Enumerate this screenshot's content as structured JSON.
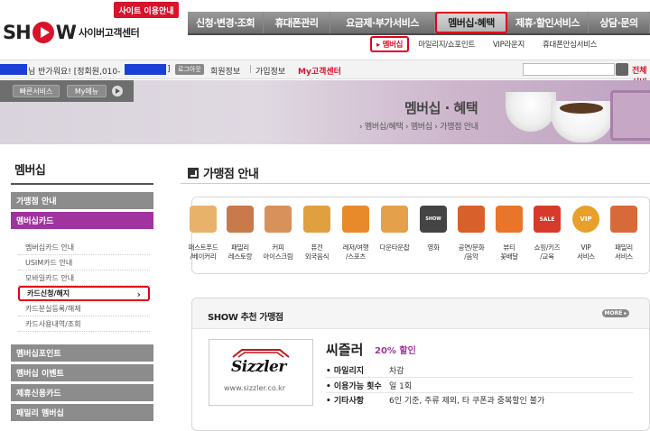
{
  "header": {
    "logo_word": "SH",
    "logo_word2": "W",
    "logo_sub": "사이버고객센터",
    "guide_label": "사이트 이용안내"
  },
  "gnb": [
    {
      "label": "신청·변경·조회",
      "active": false
    },
    {
      "label": "휴대폰관리",
      "active": false
    },
    {
      "label": "요금제·부가서비스",
      "active": false
    },
    {
      "label": "멤버십·혜택",
      "active": true
    },
    {
      "label": "제휴·할인서비스",
      "active": false
    },
    {
      "label": "상담·문의",
      "active": false
    }
  ],
  "subnav": [
    {
      "label": "멤버십",
      "active": true
    },
    {
      "label": "마일리지/쇼포인트",
      "active": false
    },
    {
      "label": "VIP라운지",
      "active": false
    },
    {
      "label": "휴대폰안심서비스",
      "active": false
    }
  ],
  "userbar": {
    "greeting": "님 반가워요! [정회원,010-",
    "greeting_end": "]",
    "logout": "로그아웃",
    "member_info": "회원정보",
    "sep": "|",
    "join_info": "가입정보",
    "my_center": "My고객센터",
    "all_services": "전체서비스"
  },
  "quick": {
    "quick_label": "빠른서비스",
    "my_menu_label": "My메뉴"
  },
  "banner": {
    "title": "멤버십 · 혜택",
    "breadcrumb": "› 멤버십/혜택 › 멤버십 › 가맹점 안내"
  },
  "leftnav": {
    "title": "멤버십",
    "main_top": [
      {
        "label": "가맹점 안내",
        "active": false
      },
      {
        "label": "멤버십카드",
        "active": true
      }
    ],
    "subs": [
      {
        "label": "멤버십카드 안내",
        "current": false
      },
      {
        "label": "USIM카드 안내",
        "current": false
      },
      {
        "label": "모바일카드 안내",
        "current": false
      },
      {
        "label": "카드신청/해지",
        "current": true
      },
      {
        "label": "카드분실등록/해제",
        "current": false
      },
      {
        "label": "카드사용내역/조회",
        "current": false
      }
    ],
    "main_bottom": [
      {
        "label": "멤버십포인트"
      },
      {
        "label": "멤버십 이벤트"
      },
      {
        "label": "제휴신용카드"
      },
      {
        "label": "패밀리 멤버십"
      }
    ]
  },
  "content": {
    "title": "가맹점 안내",
    "categories": [
      {
        "line1": "패스트푸드",
        "line2": "/베이커리",
        "color": "#e8b26a",
        "icon": "cake-icon"
      },
      {
        "line1": "패밀리",
        "line2": "레스토랑",
        "color": "#c97a4a",
        "icon": "burger-icon"
      },
      {
        "line1": "커피",
        "line2": "아이스크림",
        "color": "#d8915a",
        "icon": "coffee-cup-icon"
      },
      {
        "line1": "퓨전",
        "line2": "외국음식",
        "color": "#e0a040",
        "icon": "pizza-icon"
      },
      {
        "line1": "레저/여행",
        "line2": "/스포츠",
        "color": "#e88a2a",
        "icon": "balloon-icon"
      },
      {
        "line1": "다운타운잡",
        "line2": "",
        "color": "#e4a04a",
        "icon": "flag-icon"
      },
      {
        "line1": "영화",
        "line2": "",
        "color": "#444444",
        "icon": "clapper-icon"
      },
      {
        "line1": "공연/문화",
        "line2": "/음악",
        "color": "#d8602a",
        "icon": "ticket-icon"
      },
      {
        "line1": "뷰티",
        "line2": "꽃배달",
        "color": "#e8752a",
        "icon": "flower-icon"
      },
      {
        "line1": "쇼핑/키즈",
        "line2": "/교육",
        "color": "#d83a2a",
        "icon": "sale-tag-icon"
      },
      {
        "line1": "VIP",
        "line2": "서비스",
        "color": "#e8a02a",
        "icon": "vip-icon"
      },
      {
        "line1": "패밀리",
        "line2": "서비스",
        "color": "#d86a3a",
        "icon": "house-icon"
      }
    ],
    "sale_text": "SALE",
    "vip_text": "VIP",
    "show_text": "SHOW",
    "rec_title": "SHOW 추천 가맹점",
    "more_label": "MORE ▸",
    "partner": {
      "logo_text": "Sizzler",
      "url": "www.sizzler.co.kr",
      "name": "씨즐러",
      "discount": "20% 할인",
      "rows": [
        {
          "key": "마일리지",
          "value": "차감"
        },
        {
          "key": "이용가능 횟수",
          "value": "일 1회"
        },
        {
          "key": "기타사항",
          "value": "6인 기준, 주류 제외, 타 쿠폰과 중복할인 불가"
        }
      ]
    }
  }
}
